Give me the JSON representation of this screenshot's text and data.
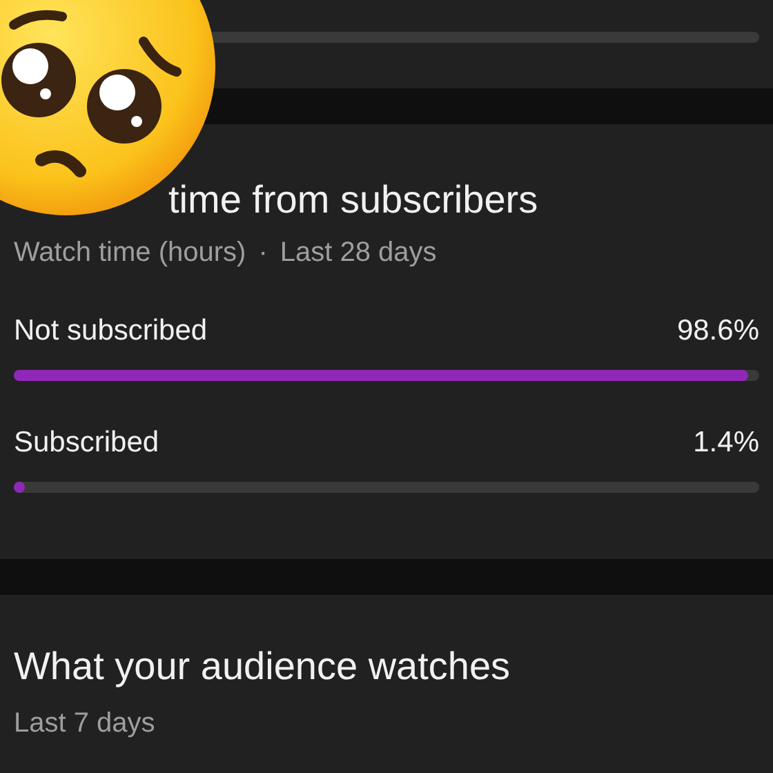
{
  "subscribers_card": {
    "title": "time from subscribers",
    "subtitle": "Watch time (hours)",
    "separator": "·",
    "period": "Last 28 days",
    "rows": [
      {
        "label": "Not subscribed",
        "value": "98.6%",
        "level": 0.986
      },
      {
        "label": "Subscribed",
        "value": "1.4%",
        "level": 0.014
      }
    ]
  },
  "audience_card": {
    "title": "What your audience watches",
    "period": "Last 7 days"
  }
}
